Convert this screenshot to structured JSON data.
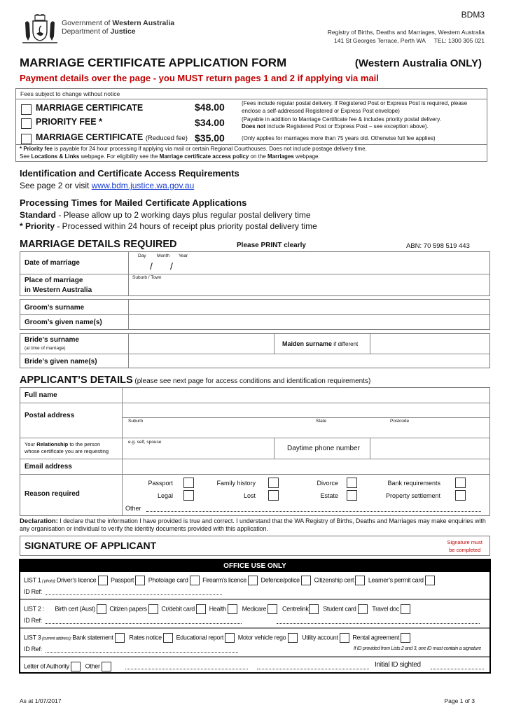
{
  "header": {
    "org_prefix": "Government of ",
    "org_bold": "Western Australia",
    "dept_prefix": "Department of ",
    "dept_bold": "Justice",
    "form_code": "BDM3",
    "registry": "Registry of Births, Deaths and Marriages, Western Australia",
    "address": "141 St Georges Terrace, Perth  WA",
    "tel": "TEL:  1300 305 021"
  },
  "title": {
    "main": "MARRIAGE CERTIFICATE APPLICATION FORM",
    "scope": "(Western Australia ONLY)",
    "payment_notice": "Payment details over the page - you MUST return pages 1 and 2 if applying via mail"
  },
  "fees": {
    "notice": "Fees subject to change without notice",
    "items": [
      {
        "label": "MARRIAGE CERTIFICATE",
        "suffix": "",
        "price": "$48.00",
        "note": "(Fees include regular postal delivery.  If Registered Post or Express Post is required, please enclose a self-addressed Registered or Express Post envelope)"
      },
      {
        "label": "PRIORITY FEE *",
        "suffix": "",
        "price": "$34.00",
        "note_prefix": "(Payable in addition to Marriage Certificate fee & includes priority postal delivery.",
        "note_bold": "Does not",
        "note_suffix": " include Registered Post or Express Post – see exception above)."
      },
      {
        "label": "MARRIAGE CERTIFICATE",
        "suffix": "(Reduced fee)",
        "price": "$35.00",
        "note": "(Only applies for marriages more than 75 years old.  Otherwise full fee applies)"
      }
    ],
    "footnote1_bold": "* Priority fee",
    "footnote1": " is payable for 24 hour processing if applying via mail or certain Regional Courthouses.  Does not include postage delivery time.",
    "footnote2_a": "See ",
    "footnote2_b": "Locations & Links",
    "footnote2_c": " webpage.  For eligibility see the ",
    "footnote2_d": "Marriage certificate access policy",
    "footnote2_e": " on the ",
    "footnote2_f": "Marriages",
    "footnote2_g": " webpage."
  },
  "id_section": {
    "heading": "Identification and Certificate Access Requirements",
    "text": "See page 2 or visit ",
    "link": "www.bdm.justice.wa.gov.au"
  },
  "processing": {
    "heading": "Processing Times for Mailed Certificate Applications",
    "standard_label": "Standard",
    "standard_text": "  - Please allow up to 2 working days plus regular postal delivery time",
    "priority_label": "* Priority",
    "priority_text": "  - Processed within 24 hours of receipt plus priority postal delivery time"
  },
  "marriage_details": {
    "heading": "MARRIAGE DETAILS REQUIRED",
    "print_note": "Please PRINT clearly",
    "abn": "ABN:  70 598 519 443",
    "date_label": "Date of marriage",
    "day": "Day",
    "month": "Month",
    "year": "Year",
    "slash": "/",
    "place_label_1": "Place of marriage",
    "place_label_2": "in Western Australia",
    "suburb_town": "Suburb / Town",
    "groom_surname": "Groom’s surname",
    "groom_given": "Groom’s given name(s)",
    "bride_surname": "Bride’s surname",
    "bride_surname_sub": "(at time of marriage)",
    "maiden_bold": "Maiden surname",
    "maiden_suffix": " if different",
    "bride_given": "Bride’s given name(s)"
  },
  "applicant": {
    "heading": "APPLICANT’S DETAILS",
    "heading_note": " (please see next page for access conditions and identification requirements)",
    "full_name": "Full name",
    "postal_address": "Postal address",
    "suburb": "Suburb",
    "state": "State",
    "postcode": "Postcode",
    "relationship_a": "Your ",
    "relationship_b": "Relationship",
    "relationship_c": " to the person",
    "relationship_d": "whose certificate you are requesting",
    "relationship_hint": "e.g. self, spouse",
    "phone": "Daytime phone number",
    "email": "Email address",
    "reason": "Reason required",
    "reasons_row1": [
      "Passport",
      "Family history",
      "Divorce",
      "Bank requirements"
    ],
    "reasons_row2": [
      "Legal",
      "Lost",
      "Estate",
      "Property settlement"
    ],
    "other": "Other"
  },
  "declaration": {
    "label": "Declaration:",
    "text": "  I declare that the information I have provided is true and correct.  I understand that the WA Registry of Births, Deaths and Marriages may make enquiries with any organisation or individual to verify the identity documents provided with this application."
  },
  "signature": {
    "heading": "SIGNATURE OF APPLICANT",
    "note_1": "Signature must",
    "note_2": "be completed"
  },
  "office": {
    "heading": "OFFICE USE ONLY",
    "list1_label": "LIST 1",
    "list1_sub": " ( photo): ",
    "list1_items": [
      "Driver’s licence",
      "Passport",
      "Photo/age card",
      "Firearm’s licence",
      "Defence/police",
      "Citizenship cert",
      "Learner’s permit card"
    ],
    "list2_label": "LIST 2 :",
    "list2_items": [
      "Birth cert (Aust)",
      "Citizen papers",
      "Cr/debit card",
      "Health",
      "Medicare",
      "Centrelink",
      "Student card",
      "Travel doc"
    ],
    "list3_label": "LIST 3",
    "list3_sub": " (current address): ",
    "list3_items": [
      "Bank statement",
      "Rates notice",
      "Educational report",
      "Motor vehicle rego",
      "Utility account",
      "Rental agreement"
    ],
    "id_ref": "ID Ref:",
    "list3_note": "If ID provided from Lists 2 and 3, one ID must contain a signature",
    "letter_of_authority": "Letter of Authority",
    "other": "Other",
    "initial": "Initial ID sighted"
  },
  "footer": {
    "date": "As at 1/07/2017",
    "page": "Page 1 of 3"
  },
  "colors": {
    "red": "#c00000",
    "link": "#1a3fd0",
    "black_bar": "#000000"
  }
}
